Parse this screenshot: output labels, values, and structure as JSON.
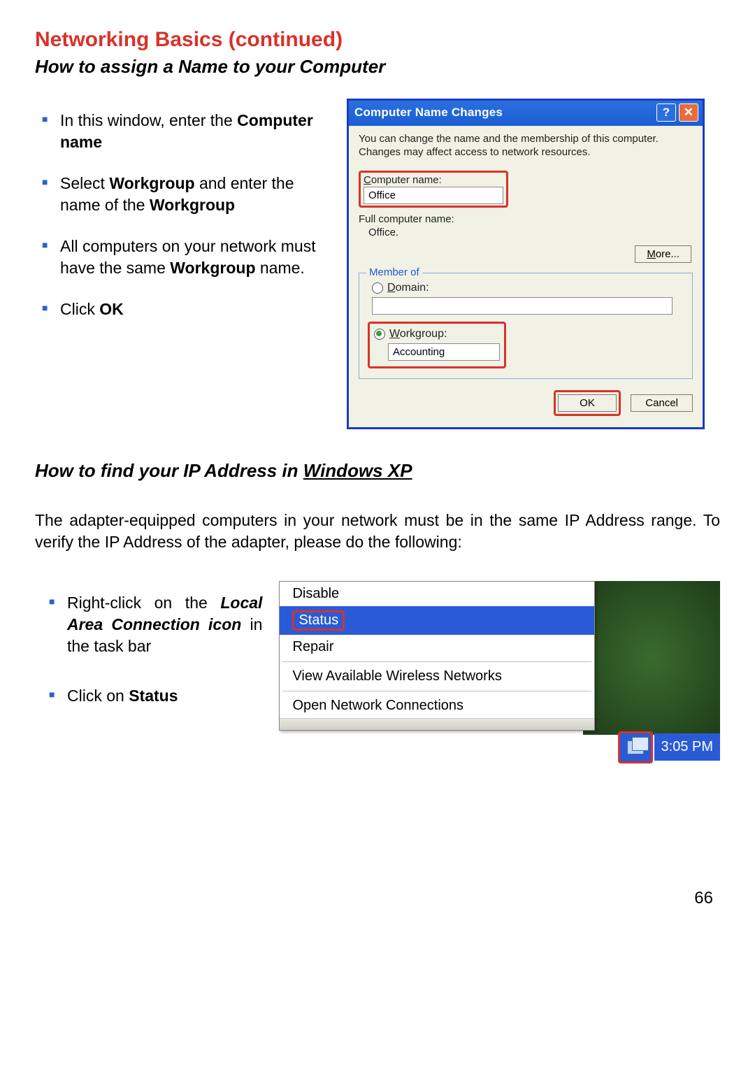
{
  "header": {
    "title": "Networking Basics   (continued)",
    "subtitle": "How to assign a Name to your Computer"
  },
  "instructions1": {
    "item1_pre": "In this window, enter the ",
    "item1_bold": "Computer name",
    "item2_pre": "Select ",
    "item2_bold1": "Workgroup",
    "item2_mid": " and enter the name of the ",
    "item2_bold2": "Workgroup",
    "item3_pre": "All computers on your network must have the same ",
    "item3_bold": "Workgroup",
    "item3_post": " name.",
    "item4_pre": "Click ",
    "item4_bold": "OK"
  },
  "dialog": {
    "title": "Computer Name Changes",
    "help_symbol": "?",
    "close_symbol": "✕",
    "description": "You can change the name and the membership of this computer. Changes may affect access to network resources.",
    "computer_name_label_pre": "C",
    "computer_name_label_rest": "omputer name:",
    "computer_name_value": "Office",
    "full_name_label": "Full computer name:",
    "full_name_value": "Office.",
    "more_label_pre": "M",
    "more_label_rest": "ore...",
    "member_of_legend": "Member of",
    "domain_label_pre": "D",
    "domain_label_rest": "omain:",
    "domain_value": "",
    "workgroup_label_pre": "W",
    "workgroup_label_rest": "orkgroup:",
    "workgroup_value": "Accounting",
    "ok_label": "OK",
    "cancel_label": "Cancel"
  },
  "section2": {
    "subtitle_pre": "How to find your IP Address in ",
    "subtitle_underline": "Windows XP",
    "body": "The adapter-equipped computers in your network must be in the same IP Address range. To verify the IP Address of the adapter, please do the following:"
  },
  "instructions2": {
    "item1_pre": "Right-click on the ",
    "item1_bolditalic": "Local Area Connection icon",
    "item1_mid": " in the task bar",
    "item2_pre": "Click on ",
    "item2_bold": "Status"
  },
  "context_menu": {
    "disable": "Disable",
    "status": "Status",
    "repair": "Repair",
    "view_wireless": "View Available Wireless Networks",
    "open_connections": "Open Network Connections"
  },
  "taskbar": {
    "time": "3:05 PM"
  },
  "page_number": "66"
}
